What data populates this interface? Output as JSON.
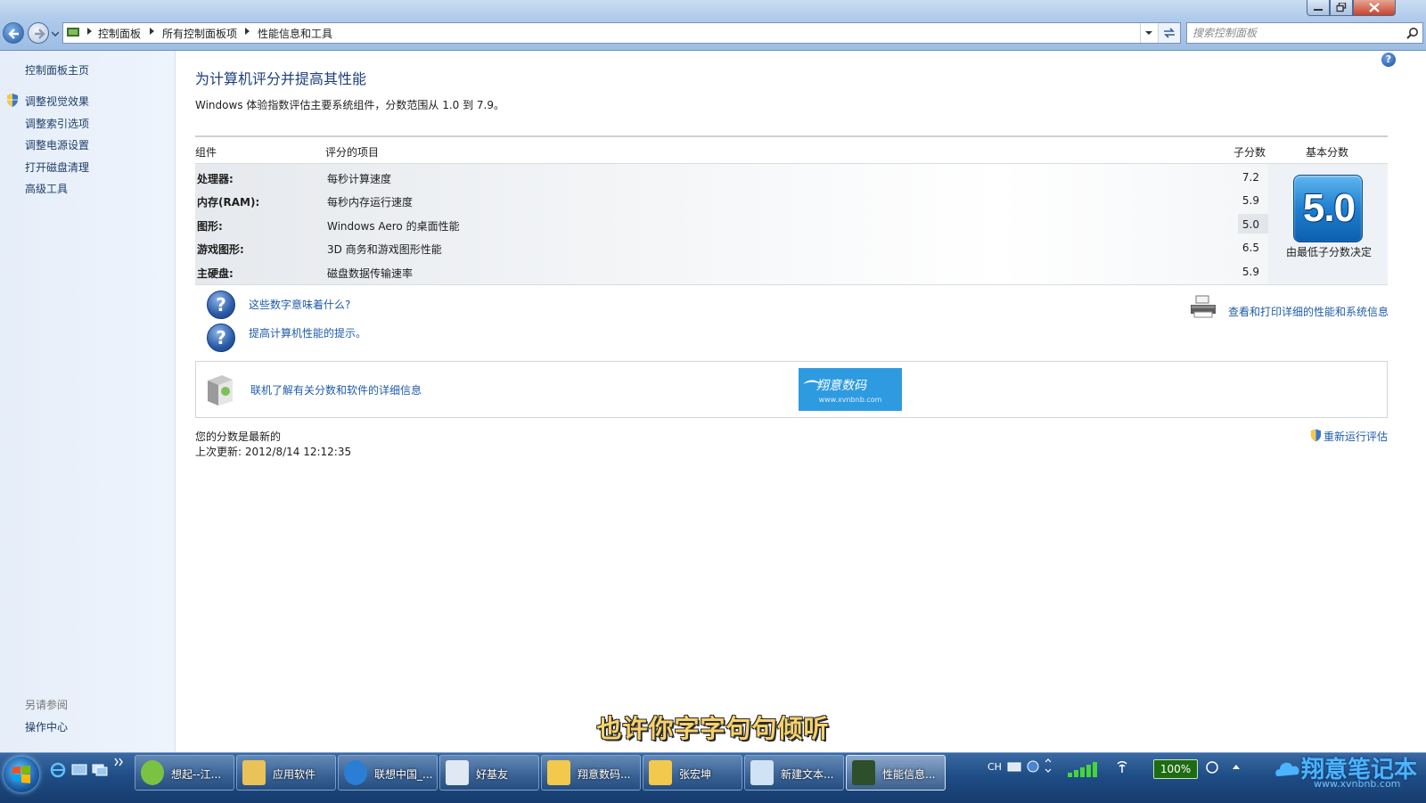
{
  "address_bar": {
    "crumbs": [
      "控制面板",
      "所有控制面板项",
      "性能信息和工具"
    ]
  },
  "search": {
    "placeholder": "搜索控制面板"
  },
  "left_pane": {
    "home": "控制面板主页",
    "links": [
      "调整视觉效果",
      "调整索引选项",
      "调整电源设置",
      "打开磁盘清理",
      "高级工具"
    ],
    "see_also_title": "另请参阅",
    "see_also": [
      "操作中心"
    ]
  },
  "main": {
    "title": "为计算机评分并提高其性能",
    "description": "Windows 体验指数评估主要系统组件，分数范围从 1.0 到 7.9。",
    "table": {
      "headers": {
        "component": "组件",
        "rated_item": "评分的项目",
        "subscore": "子分数",
        "base_score": "基本分数"
      },
      "rows": [
        {
          "component": "处理器:",
          "item": "每秒计算速度",
          "subscore": "7.2"
        },
        {
          "component": "内存(RAM):",
          "item": "每秒内存运行速度",
          "subscore": "5.9"
        },
        {
          "component": "图形:",
          "item": "Windows Aero 的桌面性能",
          "subscore": "5.0"
        },
        {
          "component": "游戏图形:",
          "item": "3D 商务和游戏图形性能",
          "subscore": "6.5"
        },
        {
          "component": "主硬盘:",
          "item": "磁盘数据传输速率",
          "subscore": "5.9"
        }
      ],
      "base_score": "5.0",
      "base_note": "由最低子分数决定"
    },
    "help_links": [
      "这些数字意味着什么?",
      "提高计算机性能的提示。"
    ],
    "print_link": "查看和打印详细的性能和系统信息",
    "online_link": "联机了解有关分数和软件的详细信息",
    "watermark": {
      "brand": "翔意数码",
      "url": "www.xvnbnb.com"
    },
    "status": "您的分数是最新的",
    "last_update": "上次更新: 2012/8/14 12:12:35",
    "rerun": "重新运行评估"
  },
  "subtitle": "也许你字字句句倾听",
  "taskbar": {
    "tasks": [
      {
        "label": "想起--江...",
        "color": "#7cc242"
      },
      {
        "label": "应用软件",
        "color": "#e9c25a"
      },
      {
        "label": "联想中国_...",
        "color": "#2a7fd4"
      },
      {
        "label": "好基友",
        "color": "#dfe8f3"
      },
      {
        "label": "翔意数码...",
        "color": "#f2c94c"
      },
      {
        "label": "张宏坤",
        "color": "#f2c94c"
      },
      {
        "label": "新建文本...",
        "color": "#cfe3f5"
      },
      {
        "label": "性能信息...",
        "color": "#2d4f2a"
      }
    ],
    "ime": "CH",
    "battery": "100%",
    "corner_brand": "翔意笔记本",
    "corner_url": "www.xvnbnb.com"
  }
}
